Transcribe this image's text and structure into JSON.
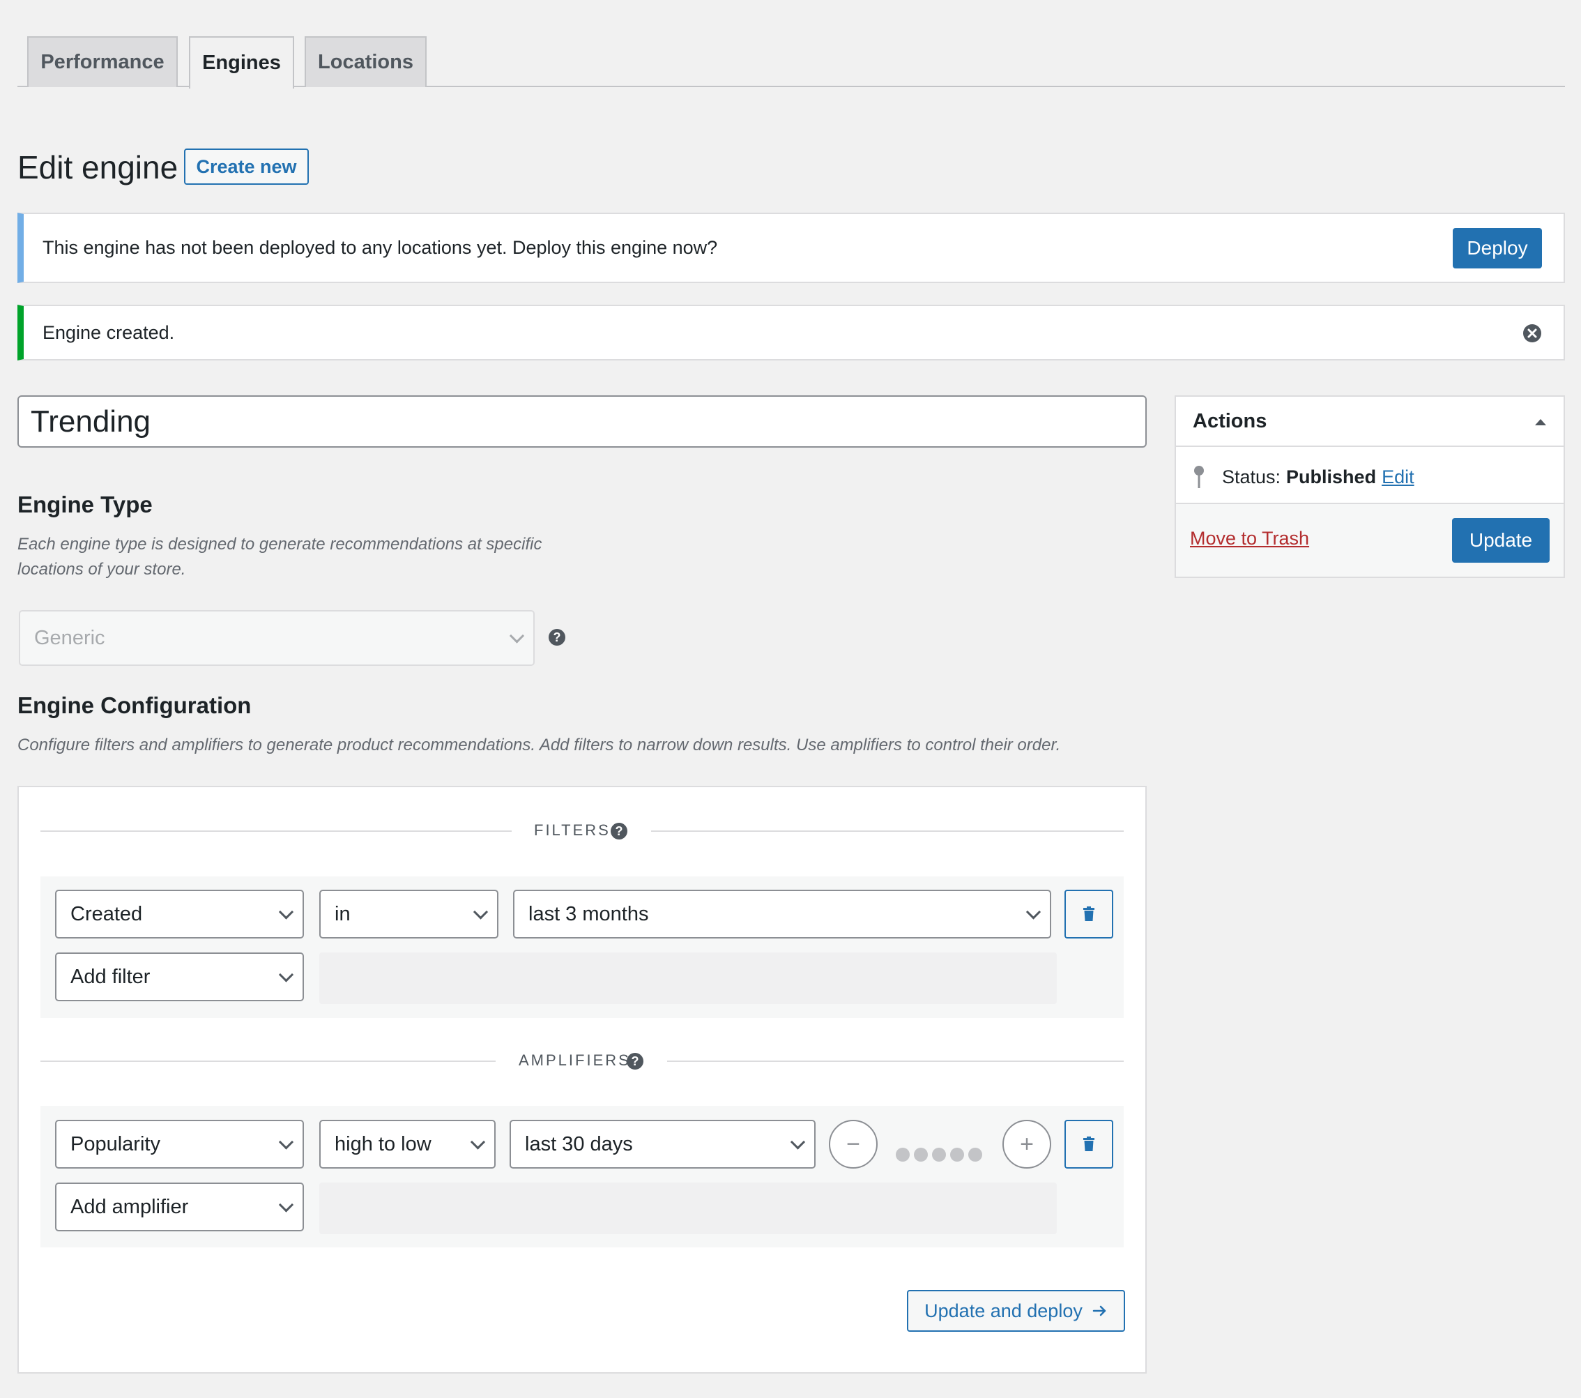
{
  "tabs": [
    {
      "label": "Performance",
      "active": false
    },
    {
      "label": "Engines",
      "active": true
    },
    {
      "label": "Locations",
      "active": false
    }
  ],
  "header": {
    "title": "Edit engine",
    "create_new_label": "Create new"
  },
  "notices": {
    "deploy_message": "This engine has not been deployed to any locations yet. Deploy this engine now?",
    "deploy_button": "Deploy",
    "created_message": "Engine created."
  },
  "engine": {
    "name": "Trending"
  },
  "engine_type": {
    "heading": "Engine Type",
    "description_line1": "Each engine type is designed to generate recommendations at specific",
    "description_line2": "locations of your store.",
    "selected": "Generic"
  },
  "engine_config": {
    "heading": "Engine Configuration",
    "description": "Configure filters and amplifiers to generate product recommendations. Add filters to narrow down results. Use amplifiers to control their order.",
    "filters_label": "FILTERS",
    "filter_row": {
      "field": "Created",
      "operator": "in",
      "value": "last 3 months"
    },
    "add_filter": "Add filter",
    "amplifiers_label": "AMPLIFIERS",
    "amplifier_row": {
      "field": "Popularity",
      "order": "high to low",
      "period": "last 30 days",
      "weight_max": 5
    },
    "add_amplifier": "Add amplifier",
    "update_deploy_label": "Update and deploy"
  },
  "actions": {
    "heading": "Actions",
    "status_label": "Status:",
    "status_value": "Published",
    "edit_link": "Edit",
    "trash_link": "Move to Trash",
    "update_button": "Update"
  },
  "colors": {
    "primary": "#2271b1",
    "info_border": "#72aee6",
    "success_border": "#00a32a",
    "danger": "#b32d2e"
  },
  "icons": [
    "help-icon",
    "close-icon",
    "trash-icon",
    "pin-icon",
    "chevron-down-icon",
    "arrow-right-icon",
    "caret-up-icon"
  ]
}
